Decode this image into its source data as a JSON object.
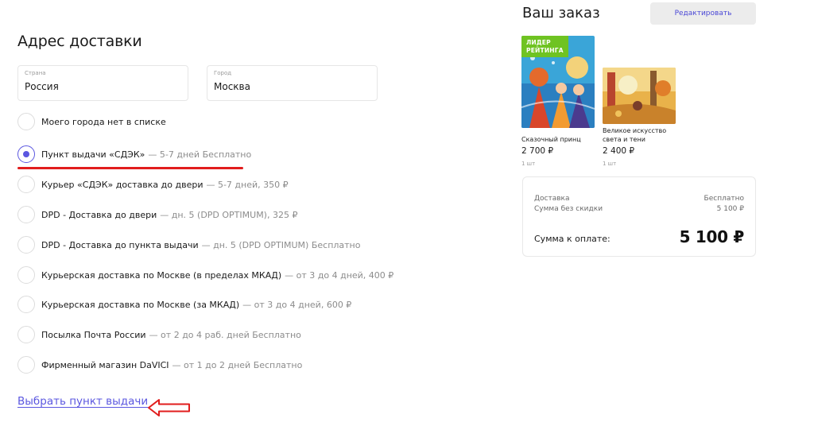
{
  "address": {
    "title": "Адрес доставки",
    "country": {
      "label": "Страна",
      "value": "Россия"
    },
    "city": {
      "label": "Город",
      "value": "Москва"
    }
  },
  "delivery_options": [
    {
      "label": "Моего города нет в списке",
      "detail": "",
      "selected": false
    },
    {
      "label": "Пункт выдачи «СДЭК»",
      "detail": "— 5-7 дней Бесплатно",
      "selected": true
    },
    {
      "label": "Курьер «СДЭК» доставка до двери",
      "detail": "— 5-7 дней, 350 ₽",
      "selected": false
    },
    {
      "label": "DPD - Доставка до двери",
      "detail": "— дн. 5 (DPD OPTIMUM), 325 ₽",
      "selected": false
    },
    {
      "label": "DPD - Доставка до пункта выдачи",
      "detail": "— дн. 5 (DPD OPTIMUM) Бесплатно",
      "selected": false
    },
    {
      "label": "Курьерская доставка по Москве (в пределах МКАД)",
      "detail": "— от 3 до 4 дней, 400 ₽",
      "selected": false
    },
    {
      "label": "Курьерская доставка по Москве (за МКАД)",
      "detail": "— от 3 до 4 дней, 600 ₽",
      "selected": false
    },
    {
      "label": "Посылка Почта России",
      "detail": "— от 2 до 4 раб. дней Бесплатно",
      "selected": false
    },
    {
      "label": "Фирменный магазин DaVICI",
      "detail": "— от 1 до 2 дней Бесплатно",
      "selected": false
    }
  ],
  "pickup_link": "Выбрать пункт выдачи",
  "order": {
    "title": "Ваш заказ",
    "edit_label": "Редактировать",
    "products": [
      {
        "badge": "ЛИДЕР\nРЕЙТИНГА",
        "name": "Сказочный принц",
        "price": "2 700 ₽",
        "qty": "1 шт"
      },
      {
        "name": "Великое искусство\nсвета и тени",
        "price": "2 400 ₽",
        "qty": "1 шт"
      }
    ],
    "summary": {
      "delivery_label": "Доставка",
      "delivery_value": "Бесплатно",
      "subtotal_label": "Сумма без скидки",
      "subtotal_value": "5 100 ₽",
      "total_label": "Сумма к оплате:",
      "total_value": "5 100 ₽"
    }
  },
  "colors": {
    "accent": "#5b57e0",
    "annotation_red": "#e11d1d",
    "badge_green": "#6fc322"
  }
}
